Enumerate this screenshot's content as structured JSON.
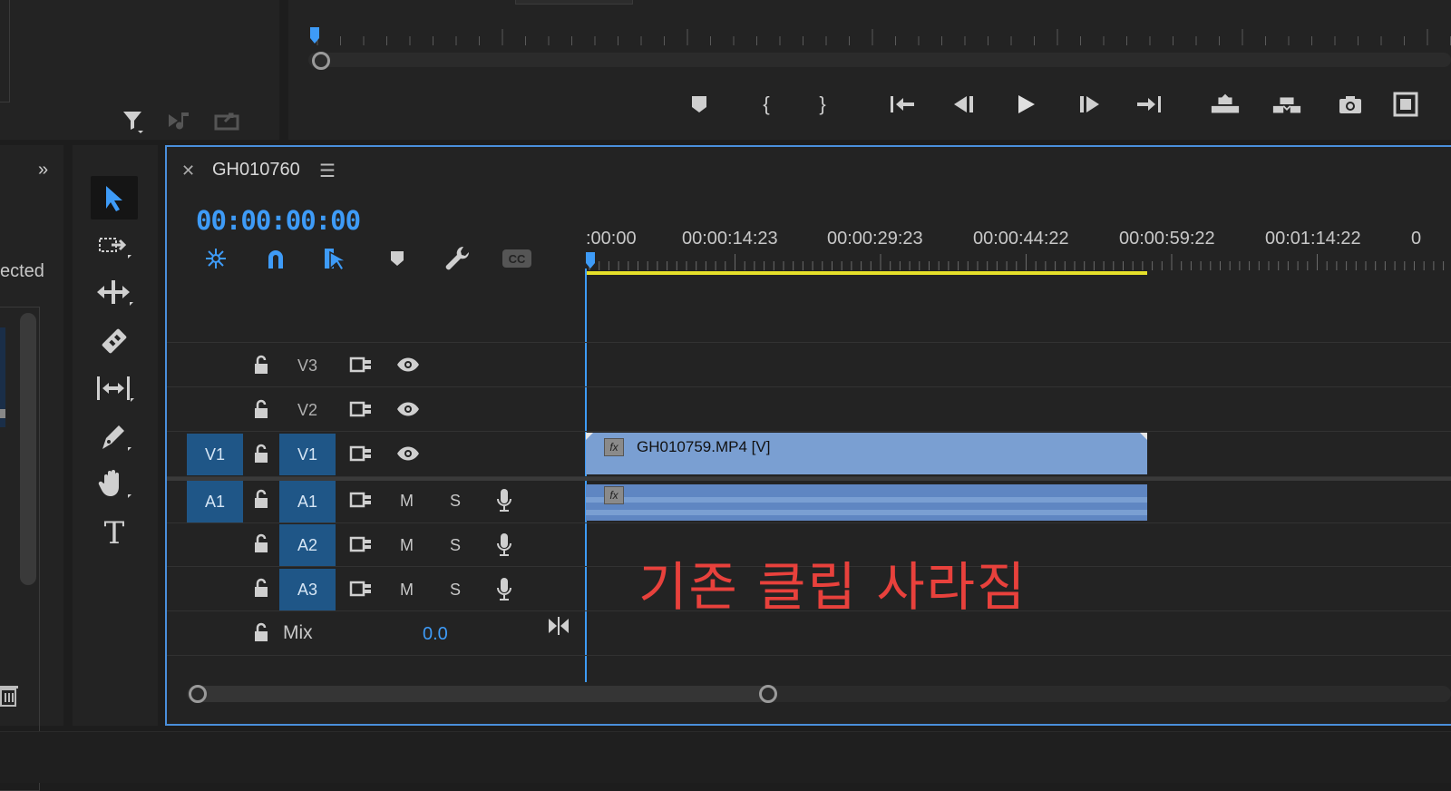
{
  "timeline": {
    "sequence_name": "GH010760",
    "timecode": "00:00:00:00",
    "ruler_labels": [
      ":00:00",
      "00:00:14:23",
      "00:00:29:23",
      "00:00:44:22",
      "00:00:59:22",
      "00:01:14:22",
      "0"
    ],
    "tracks": [
      {
        "name": "V3",
        "source": ""
      },
      {
        "name": "V2",
        "source": ""
      },
      {
        "name": "V1",
        "source": "V1"
      },
      {
        "name": "A1",
        "source": "A1",
        "m": "M",
        "s": "S"
      },
      {
        "name": "A2",
        "source": "",
        "m": "M",
        "s": "S"
      },
      {
        "name": "A3",
        "source": "",
        "m": "M",
        "s": "S"
      }
    ],
    "mix_label": "Mix",
    "mix_value": "0.0",
    "clip_video_name": "GH010759.MP4 [V]",
    "fx_label": "fx"
  },
  "project_panel": {
    "partial_text": "ected"
  },
  "annotation": "기존 클립 사라짐",
  "colors": {
    "accent": "#3e9bf7",
    "track_target": "#1f5687",
    "clip_video": "#7a9fd2",
    "clip_audio": "#5f86c2",
    "work_area": "#e6e02a",
    "annotation": "#e8413c"
  }
}
